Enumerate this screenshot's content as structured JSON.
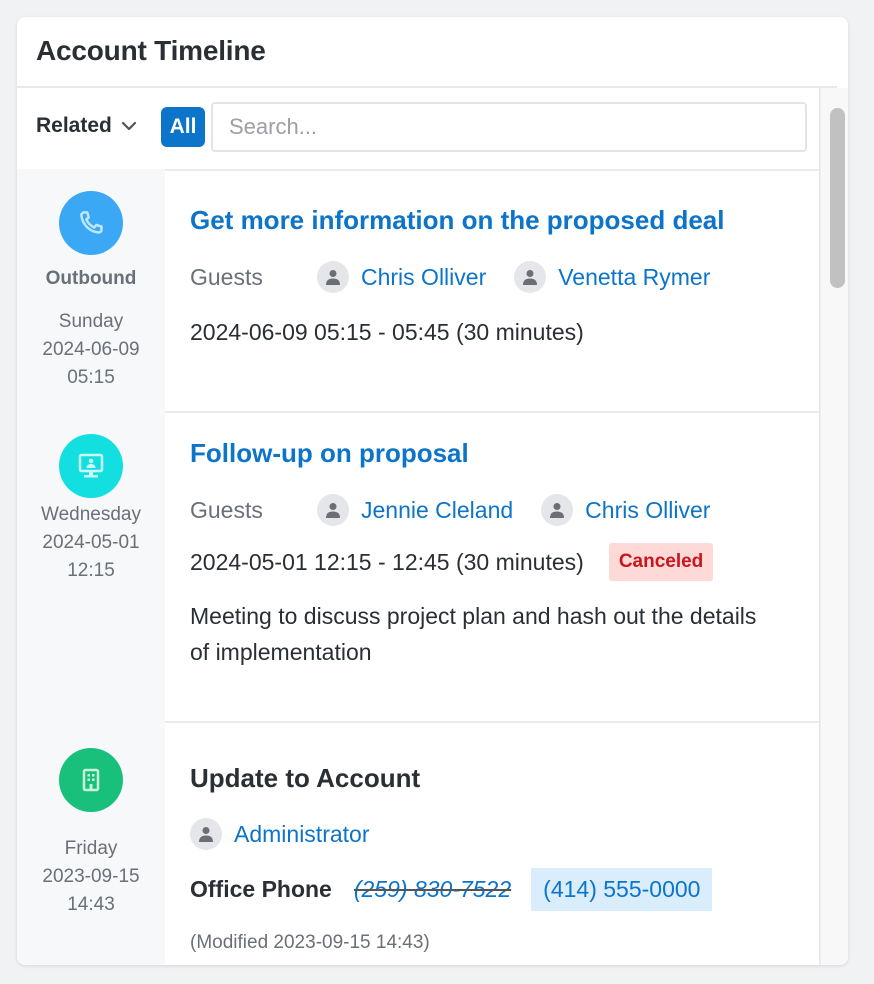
{
  "card": {
    "title": "Account Timeline"
  },
  "toolbar": {
    "related_label": "Related",
    "all_label": "All",
    "search_placeholder": "Search..."
  },
  "entries": [
    {
      "type": "call",
      "icon": "phone-icon",
      "icon_color": "#3aa8f5",
      "side_label": "Outbound",
      "day": "Sunday",
      "date": "2024-06-09",
      "time": "05:15",
      "title": "Get more information on the proposed deal",
      "guests_label": "Guests",
      "guests": [
        "Chris Olliver",
        "Venetta Rymer"
      ],
      "when": "2024-06-09 05:15 - 05:45 (30 minutes)"
    },
    {
      "type": "meeting",
      "icon": "video-meeting-icon",
      "icon_color": "#13dfe0",
      "day": "Wednesday",
      "date": "2024-05-01",
      "time": "12:15",
      "title": "Follow-up on proposal",
      "guests_label": "Guests",
      "guests": [
        "Jennie Cleland",
        "Chris Olliver"
      ],
      "when": "2024-05-01 12:15 - 12:45 (30 minutes)",
      "status": "Canceled",
      "status_color": "#c8161d",
      "description": "Meeting to discuss project plan and hash out the details of implementation"
    },
    {
      "type": "update",
      "icon": "building-icon",
      "icon_color": "#19c07c",
      "day": "Friday",
      "date": "2023-09-15",
      "time": "14:43",
      "title": "Update to Account",
      "user": "Administrator",
      "field_label": "Office Phone",
      "old_value": "(259) 830-7522",
      "new_value": "(414) 555-0000",
      "modified": "(Modified 2023-09-15 14:43)"
    }
  ]
}
